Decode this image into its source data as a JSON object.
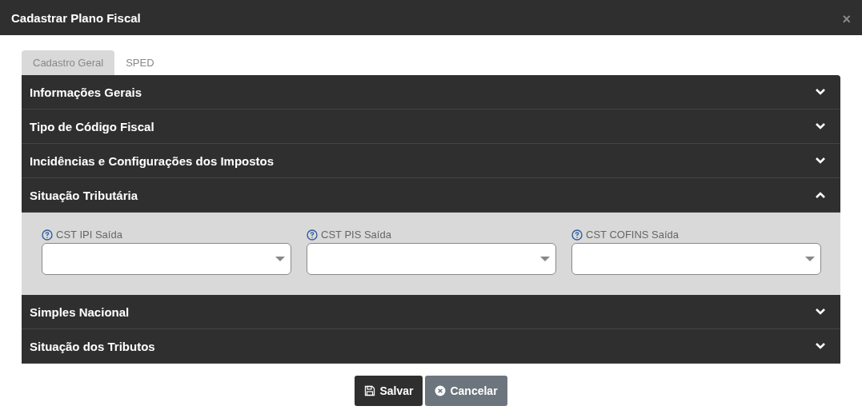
{
  "window": {
    "title": "Cadastrar Plano Fiscal",
    "close": "×"
  },
  "tabs": [
    {
      "label": "Cadastro Geral",
      "selected": true
    },
    {
      "label": "SPED",
      "selected": false
    }
  ],
  "sections": [
    {
      "title": "Informações Gerais",
      "expanded": false
    },
    {
      "title": "Tipo de Código Fiscal",
      "expanded": false
    },
    {
      "title": "Incidências e Configurações dos Impostos",
      "expanded": false
    },
    {
      "title": "Situação Tributária",
      "expanded": true,
      "fields": [
        {
          "label": "CST IPI Saída"
        },
        {
          "label": "CST PIS Saída"
        },
        {
          "label": "CST COFINS Saída"
        }
      ]
    },
    {
      "title": "Simples Nacional",
      "expanded": false
    },
    {
      "title": "Situação dos Tributos",
      "expanded": false
    }
  ],
  "buttons": [
    {
      "label": "Salvar",
      "kind": "save"
    },
    {
      "label": "Cancelar",
      "kind": "cancel"
    }
  ]
}
